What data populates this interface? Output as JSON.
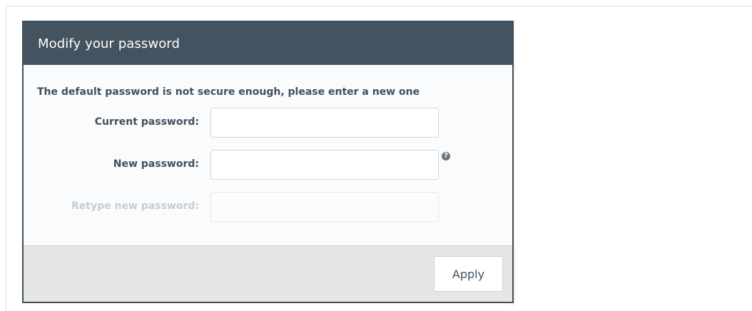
{
  "dialog": {
    "title": "Modify your password",
    "intro": "The default password is not secure enough, please enter a new one",
    "fields": {
      "current": {
        "label": "Current password:",
        "value": ""
      },
      "new": {
        "label": "New password:",
        "value": "",
        "help_icon": "question-circle-icon",
        "help_glyph": "?"
      },
      "retype": {
        "label": "Retype new password:",
        "value": "",
        "disabled": true
      }
    },
    "apply_label": "Apply"
  },
  "colors": {
    "header_bg": "#435460",
    "label_text": "#3d5163",
    "footer_bg": "#e6e6e6"
  }
}
